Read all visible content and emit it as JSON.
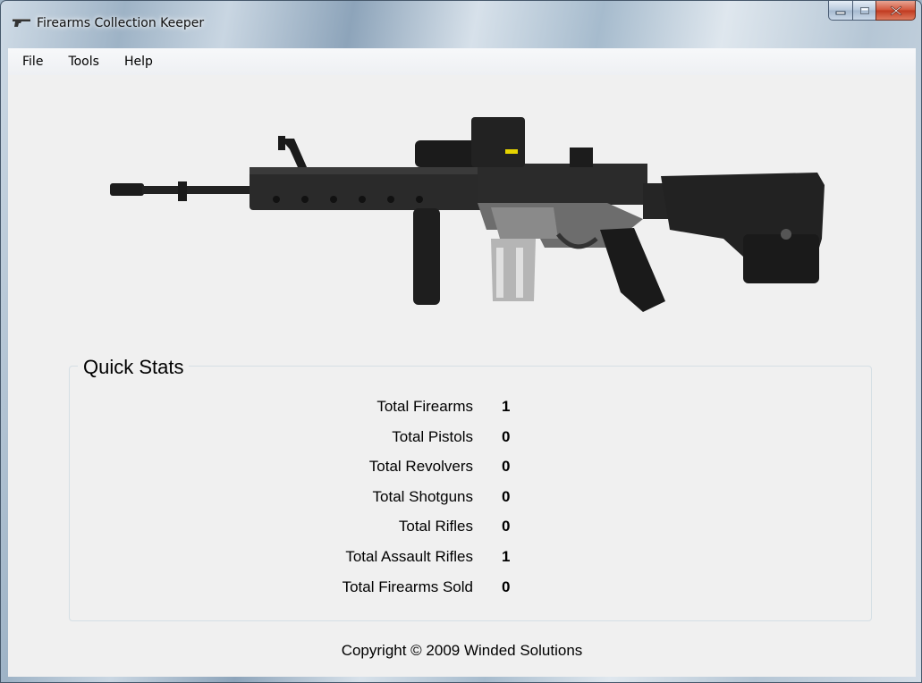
{
  "window": {
    "title": "Firearms Collection Keeper",
    "icon": "pistol-icon"
  },
  "caption_buttons": {
    "minimize": "minimize-icon",
    "maximize": "maximize-icon",
    "close": "close-icon"
  },
  "menu": {
    "items": [
      "File",
      "Tools",
      "Help"
    ]
  },
  "banner_image": "assault-rifle-image",
  "quick_stats": {
    "title": "Quick Stats",
    "rows": [
      {
        "label": "Total Firearms",
        "value": "1"
      },
      {
        "label": "Total Pistols",
        "value": "0"
      },
      {
        "label": "Total Revolvers",
        "value": "0"
      },
      {
        "label": "Total Shotguns",
        "value": "0"
      },
      {
        "label": "Total Rifles",
        "value": "0"
      },
      {
        "label": "Total Assault Rifles",
        "value": "1"
      },
      {
        "label": "Total Firearms Sold",
        "value": "0"
      }
    ]
  },
  "footer": {
    "copyright": "Copyright © 2009 Winded Solutions"
  },
  "colors": {
    "client_bg": "#f0f0f0",
    "close_button": "#c8452a",
    "frame": "#9fb4c6"
  }
}
